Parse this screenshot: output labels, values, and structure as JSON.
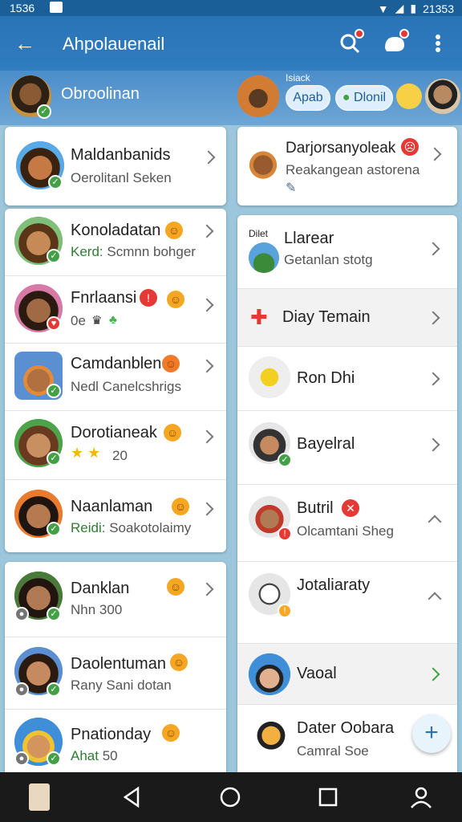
{
  "status_bar": {
    "time": "1536",
    "right_time": "21353"
  },
  "app_bar": {
    "title": "Ahpolauenail"
  },
  "sub_bar": {
    "user_name": "Obroolinan",
    "mini_label": "Isiack",
    "pill_left": "Apab",
    "pill_right": "Dlonil"
  },
  "left_list": {
    "top_item": {
      "name": "Maldanbanids",
      "sub": "Oerolitanl Seken"
    },
    "items": [
      {
        "name": "Konoladatan",
        "sub_prefix": "Kerd:",
        "sub": " Scmnn bohger"
      },
      {
        "name": "Fnrlaansi",
        "sub": "0e"
      },
      {
        "name": "Camdanblen",
        "sub": "Nedl Canelcshrigs"
      },
      {
        "name": "Dorotianeak",
        "sub": "20",
        "stars": 2
      },
      {
        "name": "Naanlaman",
        "sub_prefix": "Reidi:",
        "sub": " Soakotolaimy"
      }
    ],
    "bottom_items": [
      {
        "name": "Danklan",
        "sub": "Nhn 300",
        "sub_green": "Nhn"
      },
      {
        "name": "Daolentuman",
        "sub": "Rany Sani dotan"
      },
      {
        "name": "Pnationday",
        "sub": "50",
        "sub_green": "Ahat"
      }
    ]
  },
  "right_list": {
    "top_item": {
      "name": "Darjorsanyoleak",
      "sub": "Reakangean astorena"
    },
    "items": [
      {
        "mini": "Dilet",
        "name": "Llarear",
        "sub": "Getanlan stotg"
      },
      {
        "name": "Diay Temain"
      },
      {
        "name": "Ron Dhi"
      },
      {
        "name": "Bayelral"
      },
      {
        "name": "Butril",
        "sub": "Olcamtani Sheg"
      },
      {
        "name": "Jotaliaraty"
      },
      {
        "name": "Vaoal"
      },
      {
        "name": "Dater Oobara",
        "sub": "Camral Soe"
      }
    ]
  },
  "fab": {
    "label": "+"
  },
  "colors": {
    "primary": "#2a74b6",
    "accent": "#43a047",
    "alert": "#e53935"
  }
}
